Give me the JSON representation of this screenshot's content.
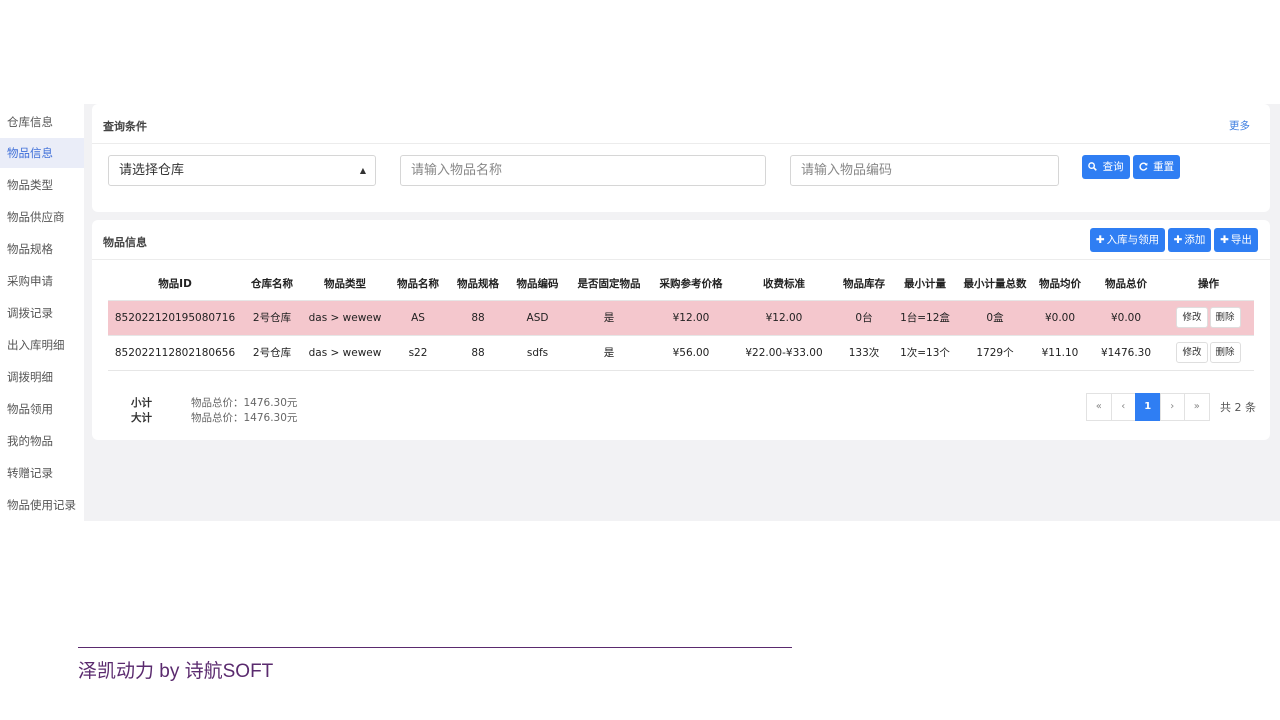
{
  "sidebar": {
    "items": [
      {
        "label": "仓库信息",
        "active": false
      },
      {
        "label": "物品信息",
        "active": true
      },
      {
        "label": "物品类型",
        "active": false
      },
      {
        "label": "物品供应商",
        "active": false
      },
      {
        "label": "物品规格",
        "active": false
      },
      {
        "label": "采购申请",
        "active": false
      },
      {
        "label": "调拨记录",
        "active": false
      },
      {
        "label": "出入库明细",
        "active": false
      },
      {
        "label": "调拨明细",
        "active": false
      },
      {
        "label": "物品领用",
        "active": false
      },
      {
        "label": "我的物品",
        "active": false
      },
      {
        "label": "转赠记录",
        "active": false
      },
      {
        "label": "物品使用记录",
        "active": false
      }
    ]
  },
  "query": {
    "title": "查询条件",
    "more_label": "更多",
    "warehouse_select": "请选择仓库",
    "name_placeholder": "请输入物品名称",
    "code_placeholder": "请输入物品编码",
    "search_label": "查询",
    "reset_label": "重置"
  },
  "items": {
    "title": "物品信息",
    "inbound_label": "入库与领用",
    "add_label": "添加",
    "export_label": "导出",
    "columns": [
      "物品ID",
      "仓库名称",
      "物品类型",
      "物品名称",
      "物品规格",
      "物品编码",
      "是否固定物品",
      "采购参考价格",
      "收费标准",
      "物品库存",
      "最小计量",
      "最小计量总数",
      "物品均价",
      "物品总价",
      "操作"
    ],
    "rows": [
      {
        "id": "852022120195080716",
        "warehouse": "2号仓库",
        "type": "das > wewew",
        "name": "AS",
        "spec": "88",
        "code": "ASD",
        "fixed": "是",
        "ref_price": "¥12.00",
        "charge": "¥12.00",
        "stock": "0台",
        "min_unit": "1台=12盒",
        "min_total": "0盒",
        "avg_price": "¥0.00",
        "total_price": "¥0.00",
        "selected": true
      },
      {
        "id": "852022112802180656",
        "warehouse": "2号仓库",
        "type": "das > wewew",
        "name": "s22",
        "spec": "88",
        "code": "sdfs",
        "fixed": "是",
        "ref_price": "¥56.00",
        "charge": "¥22.00-¥33.00",
        "stock": "133次",
        "min_unit": "1次=13个",
        "min_total": "1729个",
        "avg_price": "¥11.10",
        "total_price": "¥1476.30",
        "selected": false
      }
    ],
    "edit_label": "修改",
    "delete_label": "删除",
    "subtotal_label": "小计",
    "subtotal_value": "物品总价：1476.30元",
    "grandtotal_label": "大计",
    "grandtotal_value": "物品总价：1476.30元"
  },
  "pagination": {
    "first": "«",
    "prev": "‹",
    "current": "1",
    "next": "›",
    "last": "»",
    "total_text": "共 2 条"
  },
  "footer": {
    "text": "泽凯动力 by 诗航SOFT"
  },
  "colors": {
    "primary": "#2f7ef3",
    "selected_row": "#f4c7cd",
    "footer": "#5a2a6e",
    "sidebar_active": "#3f6fd8"
  }
}
